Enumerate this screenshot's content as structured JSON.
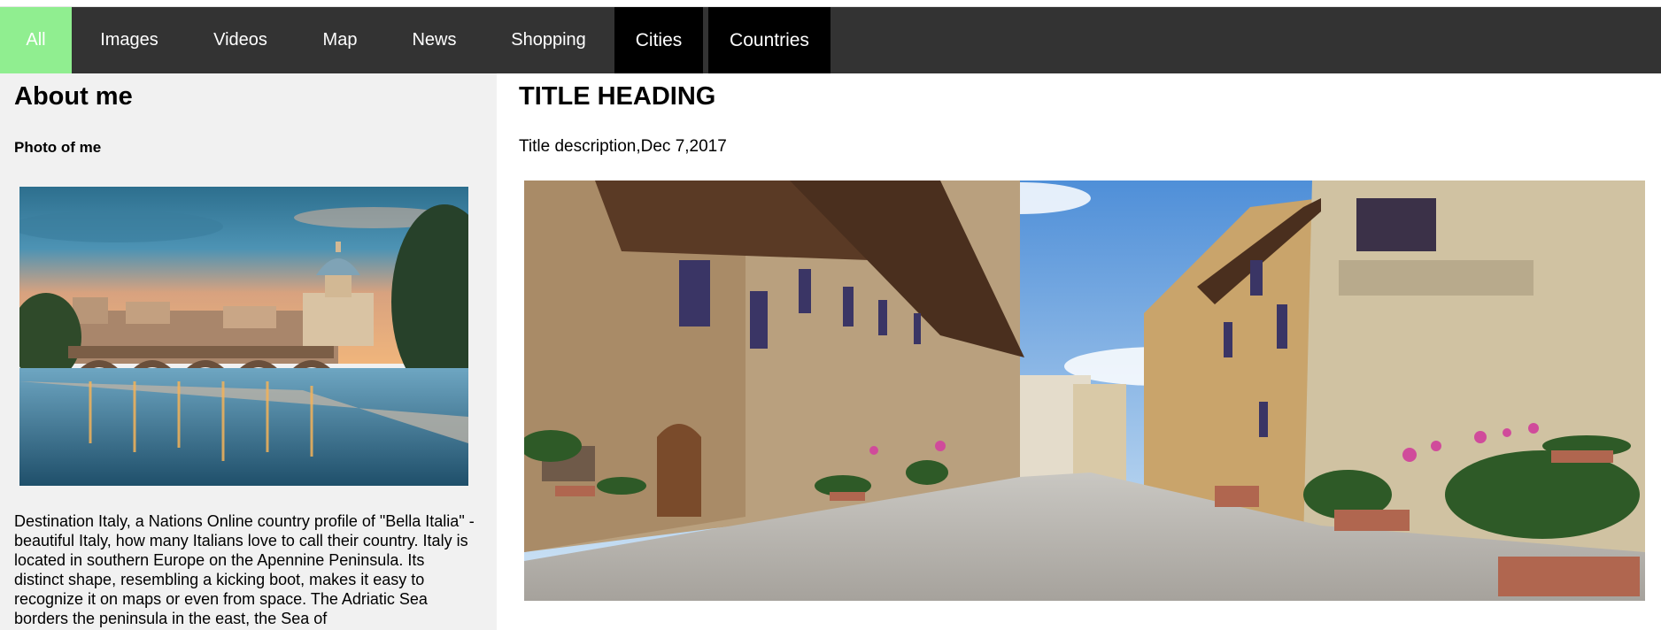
{
  "nav": {
    "items": [
      {
        "label": "All",
        "active": true
      },
      {
        "label": "Images"
      },
      {
        "label": "Videos"
      },
      {
        "label": "Map"
      },
      {
        "label": "News"
      },
      {
        "label": "Shopping"
      },
      {
        "label": "Cities"
      },
      {
        "label": "Countries"
      }
    ],
    "colors": {
      "bar": "#333333",
      "active": "#90ee90",
      "highlight": "#000000"
    }
  },
  "sidebar": {
    "heading": "About me",
    "photo_label": "Photo of me",
    "photo": "rome-river-bridge-dome-image",
    "text": "Destination Italy, a Nations Online country profile of \"Bella Italia\" - beautiful Italy, how many Italians love to call their country. Italy is located in southern Europe on the Apennine Peninsula. Its distinct shape, resembling a kicking boot, makes it easy to recognize it on maps or even from space. The Adriatic Sea borders the peninsula in the east, the Sea of"
  },
  "main": {
    "title": "TITLE HEADING",
    "description": "Title description,Dec 7,2017",
    "photo": "italian-village-street-image"
  }
}
